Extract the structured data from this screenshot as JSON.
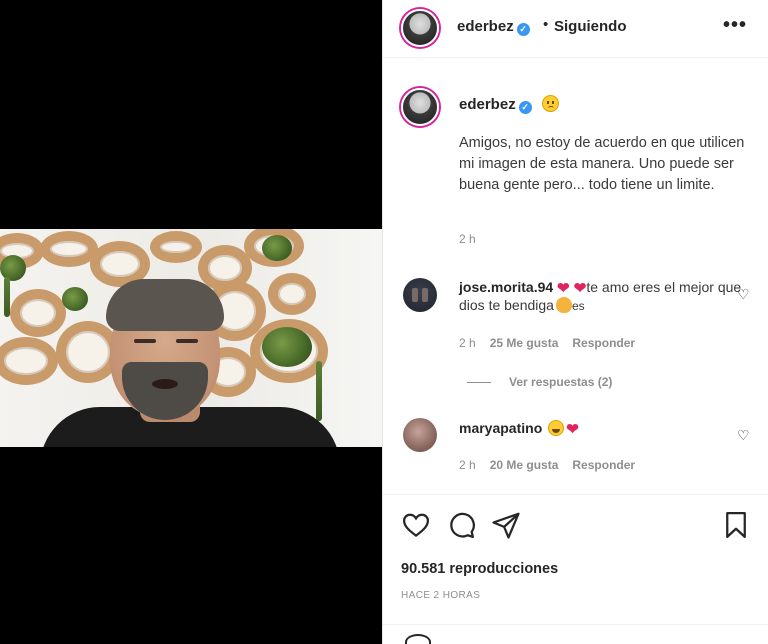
{
  "post": {
    "username": "ederbez",
    "follow_separator": "•",
    "follow_status": "Siguiendo",
    "more_icon": "ellipsis-icon",
    "caption": {
      "username": "ederbez",
      "text": "Amigos, no estoy de acuerdo en que utilicen mi imagen de esta manera. Uno puede ser buena gente pero... todo tiene un limite.",
      "time": "2 h"
    },
    "comments": [
      {
        "username": "jose.morita.94",
        "text_prefix": "❤ ❤",
        "text": "te amo eres el mejor que dios te bendiga",
        "text_suffix": "es",
        "time": "2 h",
        "likes": "25 Me gusta",
        "reply": "Responder",
        "view_replies": "Ver respuestas (2)"
      },
      {
        "username": "maryapatino",
        "text_suffix": "❤",
        "time": "2 h",
        "likes": "20 Me gusta",
        "reply": "Responder"
      }
    ],
    "views": "90.581 reproducciones",
    "time_ago": "HACE 2 HORAS"
  },
  "colors": {
    "text": "#262626",
    "muted": "#8e8e8e",
    "verified": "#3897f0",
    "heart": "#e0245e",
    "story_ring": "#d6249f"
  }
}
